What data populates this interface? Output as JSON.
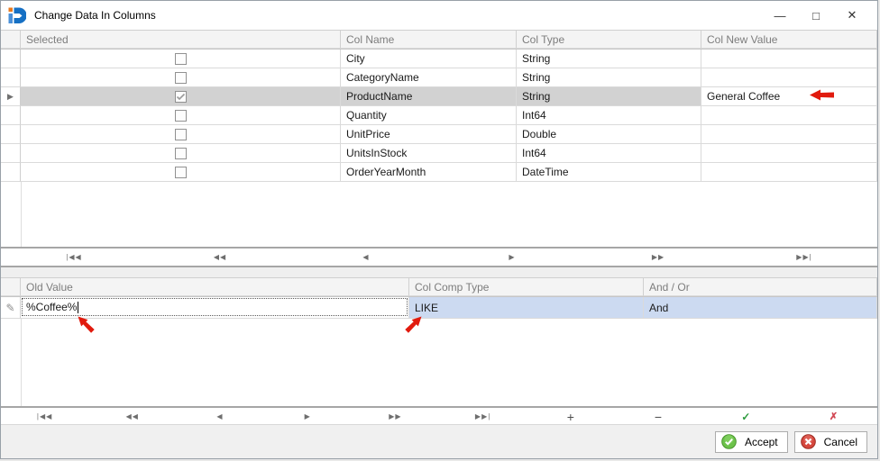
{
  "window": {
    "title": "Change Data In Columns",
    "controls": {
      "minimize": "—",
      "maximize": "□",
      "close": "✕"
    }
  },
  "grid_columns": {
    "headers": {
      "selected": "Selected",
      "col_name": "Col Name",
      "col_type": "Col Type",
      "col_new_value": "Col New Value"
    },
    "rows": [
      {
        "selected": false,
        "name": "City",
        "type": "String",
        "new_value": ""
      },
      {
        "selected": false,
        "name": "CategoryName",
        "type": "String",
        "new_value": ""
      },
      {
        "selected": true,
        "name": "ProductName",
        "type": "String",
        "new_value": "General Coffee"
      },
      {
        "selected": false,
        "name": "Quantity",
        "type": "Int64",
        "new_value": ""
      },
      {
        "selected": false,
        "name": "UnitPrice",
        "type": "Double",
        "new_value": ""
      },
      {
        "selected": false,
        "name": "UnitsInStock",
        "type": "Int64",
        "new_value": ""
      },
      {
        "selected": false,
        "name": "OrderYearMonth",
        "type": "DateTime",
        "new_value": ""
      }
    ],
    "current_row": "ProductName",
    "navigator": {
      "first": "|◀◀",
      "prev_page": "◀◀",
      "prev": "◀",
      "next": "▶",
      "next_page": "▶▶",
      "last": "▶▶|"
    }
  },
  "grid_filter": {
    "headers": {
      "old_value": "Old Value",
      "col_comp_type": "Col Comp Type",
      "and_or": "And / Or"
    },
    "row": {
      "old_value": "%Coffee%",
      "col_comp_type": "LIKE",
      "and_or": "And"
    },
    "navigator": {
      "first": "|◀◀",
      "prev_page": "◀◀",
      "prev": "◀",
      "next": "▶",
      "next_page": "▶▶",
      "last": "▶▶|",
      "add": "+",
      "remove": "−",
      "commit": "✓",
      "cancel": "✗"
    }
  },
  "icons": {
    "current_row_marker": "▶",
    "edit_pencil": "✎"
  },
  "footer": {
    "accept": "Accept",
    "cancel": "Cancel"
  },
  "colors": {
    "selection_blue": "#ccdaf1",
    "current_row_gray": "#d2d2d2",
    "accept_green": "#5fb844",
    "cancel_red": "#cf3e35",
    "annotation_red": "#e11b0e"
  }
}
